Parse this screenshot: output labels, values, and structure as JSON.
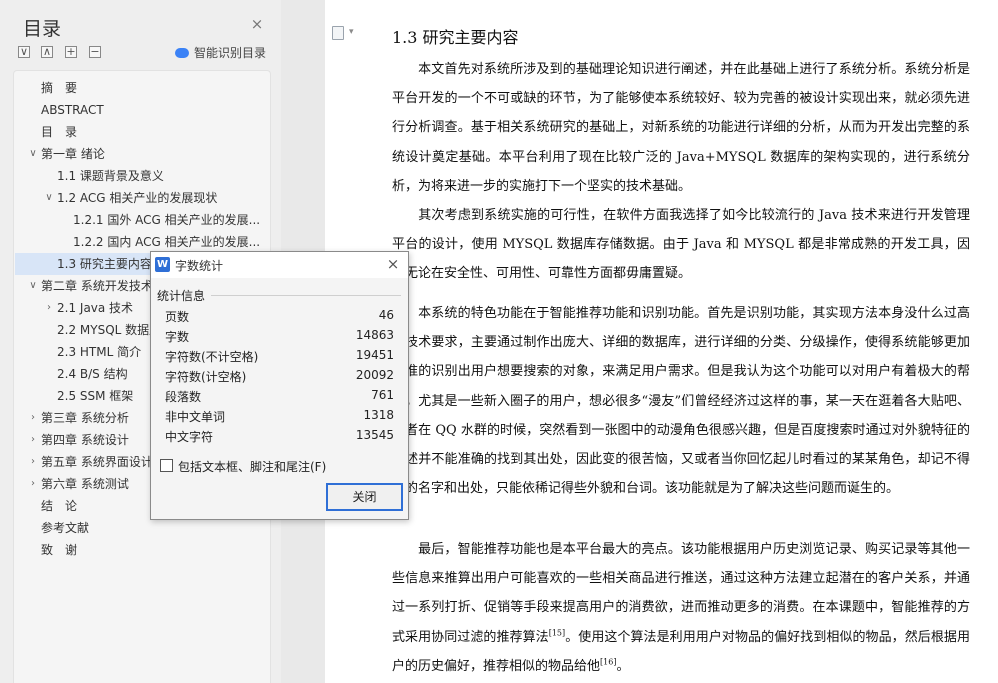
{
  "sidebar": {
    "title": "目录",
    "close_icon": "×",
    "toolbar_icons": [
      "∨",
      "∧",
      "+",
      "−"
    ],
    "smart_toc_label": "智能识别目录",
    "items": [
      {
        "label": "摘　要",
        "level": 0,
        "chevron": ""
      },
      {
        "label": "ABSTRACT",
        "level": 0,
        "chevron": ""
      },
      {
        "label": "目　录",
        "level": 0,
        "chevron": ""
      },
      {
        "label": "第一章  绪论",
        "level": 0,
        "chevron": "∨"
      },
      {
        "label": "1.1  课题背景及意义",
        "level": 1,
        "chevron": ""
      },
      {
        "label": "1.2 ACG 相关产业的发展现状",
        "level": 1,
        "chevron": "∨"
      },
      {
        "label": "1.2.1 国外 ACG 相关产业的发展...",
        "level": 2,
        "chevron": ""
      },
      {
        "label": "1.2.2 国内 ACG 相关产业的发展...",
        "level": 2,
        "chevron": ""
      },
      {
        "label": "1.3  研究主要内容",
        "level": 1,
        "chevron": "",
        "active": true
      },
      {
        "label": "第二章  系统开发技术",
        "level": 0,
        "chevron": "∨"
      },
      {
        "label": "2.1 Java 技术",
        "level": 1,
        "chevron": "›"
      },
      {
        "label": "2.2 MYSQL 数据库",
        "level": 1,
        "chevron": ""
      },
      {
        "label": "2.3 HTML 简介",
        "level": 1,
        "chevron": ""
      },
      {
        "label": "2.4 B/S 结构",
        "level": 1,
        "chevron": ""
      },
      {
        "label": "2.5 SSM 框架",
        "level": 1,
        "chevron": ""
      },
      {
        "label": "第三章  系统分析",
        "level": 0,
        "chevron": "›"
      },
      {
        "label": "第四章  系统设计",
        "level": 0,
        "chevron": "›"
      },
      {
        "label": "第五章  系统界面设计",
        "level": 0,
        "chevron": "›"
      },
      {
        "label": "第六章  系统测试",
        "level": 0,
        "chevron": "›"
      },
      {
        "label": "结　论",
        "level": 0,
        "chevron": ""
      },
      {
        "label": "参考文献",
        "level": 0,
        "chevron": ""
      },
      {
        "label": "致　谢",
        "level": 0,
        "chevron": ""
      }
    ]
  },
  "document": {
    "heading": "1.3  研究主要内容",
    "paragraphs": [
      "本文首先对系统所涉及到的基础理论知识进行阐述，并在此基础上进行了系统分析。系统分析是平台开发的一个不可或缺的环节，为了能够使本系统较好、较为完善的被设计实现出来，就必须先进行分析调查。基于相关系统研究的基础上，对新系统的功能进行详细的分析，从而为开发出完整的系统设计奠定基础。本平台利用了现在比较广泛的 Java+MYSQL 数据库的架构实现的，进行系统分析，为将来进一步的实施打下一个坚实的技术基础。",
      "其次考虑到系统实施的可行性，在软件方面我选择了如今比较流行的 Java 技术来进行开发管理平台的设计，使用 MYSQL 数据库存储数据。由于 Java 和 MYSQL 都是非常成熟的开发工具，因此无论在安全性、可用性、可靠性方面都毋庸置疑。",
      "本系统的特色功能在于智能推荐功能和识别功能。首先是识别功能，其实现方法本身没什么过高的技术要求，主要通过制作出庞大、详细的数据库，进行详细的分类、分级操作，使得系统能够更加精准的识别出用户想要搜索的对象，来满足用户需求。但是我认为这个功能可以对用户有着极大的帮助，尤其是一些新入圈子的用户，想必很多“漫友”们曾经经济过这样的事，某一天在逛着各大贴吧、或者在 QQ 水群的时候，突然看到一张图中的动漫角色很感兴趣，但是百度搜索时通过对外貌特征的描述并不能准确的找到其出处，因此变的很苦恼，又或者当你回忆起儿时看过的某某角色，却记不得他的名字和出处，只能依稀记得些外貌和台词。该功能就是为了解决这些问题而诞生的。",
      "最后，智能推荐功能也是本平台最大的亮点。该功能根据用户历史浏览记录、购买记录等其他一些信息来推算出用户可能喜欢的一些相关商品进行推送，通过这种方法建立起潜在的客户关系，并通过一系列打折、促销等手段来提高用户的消费欲，进而推动更多的消费。在本课题中，智能推荐的方式采用协同过滤的推荐算法",
      "。使用这个算法是利用用户对物品的偏好找到相似的物品，然后根据用户的历史偏好，推荐相似的物品给他",
      "。"
    ],
    "cite_15": "[15]",
    "cite_16": "[16]"
  },
  "dialog": {
    "app_icon": "W",
    "title": "字数统计",
    "close_icon": "×",
    "section": "统计信息",
    "stats": [
      {
        "label": "页数",
        "value": "46"
      },
      {
        "label": "字数",
        "value": "14863"
      },
      {
        "label": "字符数(不计空格)",
        "value": "19451"
      },
      {
        "label": "字符数(计空格)",
        "value": "20092"
      },
      {
        "label": "段落数",
        "value": "761"
      },
      {
        "label": "非中文单词",
        "value": "1318"
      },
      {
        "label": "中文字符",
        "value": "13545"
      }
    ],
    "checkbox_label": "包括文本框、脚注和尾注(F)",
    "checkbox_checked": false,
    "close_button": "关闭"
  }
}
